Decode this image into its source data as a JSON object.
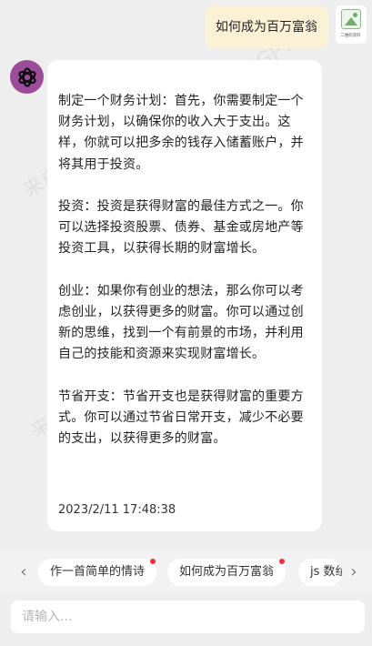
{
  "user_message": {
    "text": "如何成为百万富翁",
    "avatar_caption": "二维码资料"
  },
  "bot_message": {
    "paragraphs": [
      "制定一个财务计划：首先，你需要制定一个财务计划，以确保你的收入大于支出。这样，你就可以把多余的钱存入储蓄账户，并将其用于投资。",
      "投资：投资是获得财富的最佳方式之一。你可以选择投资股票、债券、基金或房地产等投资工具，以获得长期的财富增长。",
      "创业：如果你有创业的想法，那么你可以考虑创业，以获得更多的财富。你可以通过创新的思维，找到一个有前景的市场，并利用自己的技能和资源来实现财富增长。",
      "节省开支：节省开支也是获得财富的重要方式。你可以通过节省日常开支，减少不必要的支出，以获得更多的财富。"
    ],
    "timestamp": "2023/2/11 17:48:38"
  },
  "suggestions": {
    "prev_icon": "‹",
    "next_icon": "›",
    "chips": [
      "作一首简单的情诗",
      "如何成为百万富翁",
      "js 数组"
    ]
  },
  "input": {
    "placeholder": "请输入..."
  },
  "colors": {
    "user_bubble": "#fbf2d6",
    "bot_avatar": "#9c4d9a",
    "badge": "#f0303c"
  }
}
